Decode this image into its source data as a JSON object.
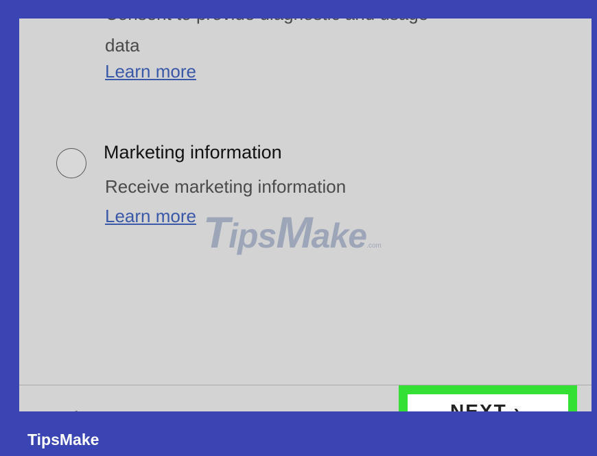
{
  "consent": {
    "text_cutoff": "Consent to provide diagnostic and usage",
    "text_cont": "data",
    "learn_more": "Learn more"
  },
  "marketing": {
    "title": "Marketing information",
    "description": "Receive marketing information",
    "learn_more": "Learn more"
  },
  "footer": {
    "back_chevron": "‹",
    "next_label": "NEXT ›"
  },
  "watermark": {
    "t": "T",
    "ips": "ips",
    "m": "M",
    "ake": "ake",
    "com": ".com"
  },
  "brand": "TipsMake",
  "colors": {
    "frame": "#3a45b3",
    "screen_bg": "#d3d3d3",
    "link": "#3a58a8",
    "highlight": "#35e035"
  }
}
